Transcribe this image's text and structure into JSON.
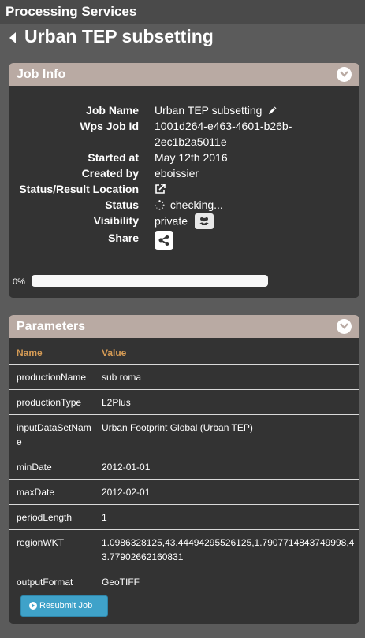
{
  "app": {
    "title": "Processing Services"
  },
  "page": {
    "title": "Urban TEP subsetting"
  },
  "job_info": {
    "header": "Job Info",
    "rows": {
      "job_name": {
        "label": "Job Name",
        "value": "Urban TEP subsetting"
      },
      "wps_job_id": {
        "label": "Wps Job Id",
        "value_line1": "1001d264-e463-4601-b26b-",
        "value_line2": "2ec1b2a5011e"
      },
      "started_at": {
        "label": "Started at",
        "value": "May 12th 2016"
      },
      "created_by": {
        "label": "Created by",
        "value": "eboissier"
      },
      "status_location": {
        "label": "Status/Result Location"
      },
      "status": {
        "label": "Status",
        "value": "checking..."
      },
      "visibility": {
        "label": "Visibility",
        "value": "private"
      },
      "share": {
        "label": "Share"
      }
    },
    "progress": {
      "label": "0%",
      "fraction": 0
    }
  },
  "parameters": {
    "header": "Parameters",
    "columns": {
      "name": "Name",
      "value": "Value"
    },
    "rows": [
      {
        "name": "productionName",
        "value": "sub roma"
      },
      {
        "name": "productionType",
        "value": "L2Plus"
      },
      {
        "name": "inputDataSetName",
        "value": "Urban Footprint Global (Urban TEP)"
      },
      {
        "name": "minDate",
        "value": "2012-01-01"
      },
      {
        "name": "maxDate",
        "value": "2012-02-01"
      },
      {
        "name": "periodLength",
        "value": "1"
      },
      {
        "name": "regionWKT",
        "value": "1.0986328125,43.44494295526125,1.7907714843749998,43.77902662160831"
      },
      {
        "name": "outputFormat",
        "value": "GeoTIFF"
      }
    ],
    "resubmit_label": "Resubmit Job"
  },
  "colors": {
    "background": "#5b5b5b",
    "panel": "#333333",
    "panel_header": "#b9aaa3",
    "column_header": "#d59b55",
    "button": "#3fa2c9"
  },
  "icons": [
    "chevron-left-icon",
    "chevron-down-icon",
    "pencil-icon",
    "external-link-icon",
    "spinner-icon",
    "group-icon",
    "share-icon",
    "play-circle-icon"
  ]
}
